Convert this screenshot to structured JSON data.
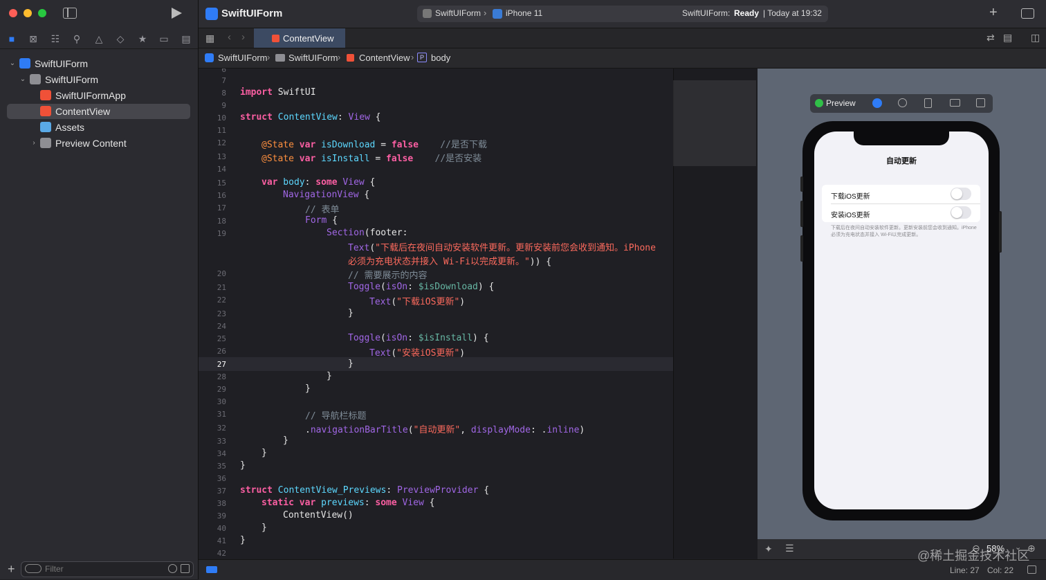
{
  "window": {
    "project_title": "SwiftUIForm",
    "scheme": "SwiftUIForm",
    "device": "iPhone 11",
    "status_app": "SwiftUIForm:",
    "status_state": "Ready",
    "status_time": "| Today at 19:32"
  },
  "navigator": {
    "items": [
      {
        "label": "SwiftUIForm"
      },
      {
        "label": "SwiftUIForm"
      },
      {
        "label": "SwiftUIFormApp"
      },
      {
        "label": "ContentView"
      },
      {
        "label": "Assets"
      },
      {
        "label": "Preview Content"
      }
    ],
    "filter_placeholder": "Filter"
  },
  "editor": {
    "tab": "ContentView",
    "breadcrumb": [
      "SwiftUIForm",
      "SwiftUIForm",
      "ContentView",
      "body"
    ],
    "line_numbers": [
      "6",
      "7",
      "8",
      "9",
      "10",
      "11",
      "12",
      "13",
      "14",
      "15",
      "16",
      "17",
      "18",
      "19",
      "20",
      "21",
      "22",
      "23",
      "24",
      "25",
      "26",
      "27",
      "28",
      "29",
      "30",
      "31",
      "32",
      "33",
      "34",
      "35",
      "36",
      "37",
      "38",
      "39",
      "40",
      "41",
      "42"
    ],
    "code": {
      "l8_kw": "import",
      "l8_rest": " SwiftUI",
      "l10_kw": "struct",
      "l10_name": " ContentView",
      "l10_colon": ": ",
      "l10_type": "View",
      "l10_brace": " {",
      "l12_attr": "@State",
      "l12_kw": " var",
      "l12_name": " isDownload",
      "l12_eq": " = ",
      "l12_val": "false",
      "l12_cm": "    //是否下载",
      "l13_attr": "@State",
      "l13_kw": " var",
      "l13_name": " isInstall",
      "l13_eq": " = ",
      "l13_val": "false",
      "l13_cm": "    //是否安装",
      "l15_kw": "var",
      "l15_name": " body",
      "l15_colon": ": ",
      "l15_kw2": "some",
      "l15_type": " View",
      "l15_brace": " {",
      "l16_type": "NavigationView",
      "l16_brace": " {",
      "l17_cm": "// 表单",
      "l18_type": "Form",
      "l18_brace": " {",
      "l19_type": "Section",
      "l19_rest": "(footer:",
      "l19b_type": "Text",
      "l19b_p": "(",
      "l19b_str": "\"下载后在夜间自动安装软件更新。更新安装前您会收到通知。iPhone",
      "l19c_str": "必须为充电状态并接入 Wi-Fi以完成更新。\"",
      "l19c_rest": ")) {",
      "l20_cm": "// 需要展示的内容",
      "l21_type": "Toggle",
      "l21_p": "(",
      "l21_arg": "isOn",
      "l21_colon": ": ",
      "l21_bind": "$isDownload",
      "l21_rest": ") {",
      "l22_type": "Text",
      "l22_p": "(",
      "l22_str": "\"下载iOS更新\"",
      "l22_rest": ")",
      "l23": "}",
      "l25_type": "Toggle",
      "l25_p": "(",
      "l25_arg": "isOn",
      "l25_colon": ": ",
      "l25_bind": "$isInstall",
      "l25_rest": ") {",
      "l26_type": "Text",
      "l26_p": "(",
      "l26_str": "\"安装iOS更新\"",
      "l26_rest": ")",
      "l27": "}",
      "l28": "}",
      "l29": "}",
      "l31_cm": "// 导航栏标题",
      "l32_dot": ".",
      "l32_fn": "navigationBarTitle",
      "l32_p": "(",
      "l32_str": "\"自动更新\"",
      "l32_comma": ", ",
      "l32_arg": "displayMode",
      "l32_colon": ": .",
      "l32_val": "inline",
      "l32_rest": ")",
      "l33": "}",
      "l34": "}",
      "l35": "}",
      "l37_kw": "struct",
      "l37_name": " ContentView_Previews",
      "l37_colon": ": ",
      "l37_type": "PreviewProvider",
      "l37_brace": " {",
      "l38_kw": "static",
      "l38_kw2": " var",
      "l38_name": " previews",
      "l38_colon": ": ",
      "l38_kw3": "some",
      "l38_type": " View",
      "l38_brace": " {",
      "l39_type": "ContentView",
      "l39_rest": "()",
      "l40": "}",
      "l41": "}"
    }
  },
  "preview": {
    "label": "Preview",
    "nav_title": "自动更新",
    "toggles": [
      {
        "label": "下载iOS更新",
        "on": false
      },
      {
        "label": "安装iOS更新",
        "on": false
      }
    ],
    "footer": "下载后在夜间自动安装软件更新。更新安装前您会收到通知。iPhone 必须为充电状态并接入 Wi-Fi以完成更新。",
    "zoom": "58%"
  },
  "status": {
    "line": "Line: 27",
    "col": "Col: 22"
  },
  "watermark": "@稀土掘金技术社区",
  "colors": {
    "accent": "#2f7cf6",
    "keyword": "#fc5fa3",
    "type": "#5dd8ff",
    "string": "#fc6a5d",
    "comment": "#7f8c98",
    "preview_green": "#30c048"
  }
}
